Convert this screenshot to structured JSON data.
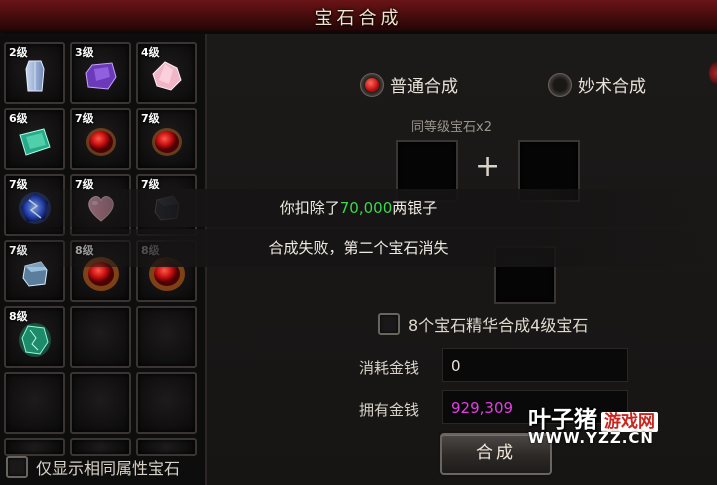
{
  "window": {
    "title": "宝石合成"
  },
  "inventory": {
    "slots": [
      {
        "level": "2级",
        "gem": "blue-crystal-gem-icon"
      },
      {
        "level": "3级",
        "gem": "purple-gem-icon"
      },
      {
        "level": "4级",
        "gem": "pink-crystal-gem-icon"
      },
      {
        "level": "6级",
        "gem": "green-rectangular-gem-icon"
      },
      {
        "level": "7级",
        "gem": "red-oval-gem-icon"
      },
      {
        "level": "7级",
        "gem": "red-oval-gem-icon"
      },
      {
        "level": "7级",
        "gem": "blue-lightning-gem-icon"
      },
      {
        "level": "7级",
        "gem": "pink-heart-gem-icon"
      },
      {
        "level": "7级",
        "gem": "ice-cube-gem-icon"
      },
      {
        "level": "7级",
        "gem": "ice-cube-gem-icon"
      },
      {
        "level": "8级",
        "gem": "red-oval-gem-icon"
      },
      {
        "level": "8级",
        "gem": "red-oval-gem-icon"
      },
      {
        "level": "8级",
        "gem": "green-cracked-gem-icon"
      }
    ],
    "show_same_label": "仅显示相同属性宝石"
  },
  "synthesis": {
    "modes": [
      {
        "label": "普通合成",
        "selected": true
      },
      {
        "label": "妙术合成",
        "selected": false
      }
    ],
    "hint": "同等级宝石x2",
    "plus": "+",
    "notice_1": {
      "prefix": "你扣除了",
      "amount": "70,000",
      "suffix": "两银子"
    },
    "notice_2": "合成失败，第二个宝石消失",
    "combine8_label": "8个宝石精华合成4级宝石",
    "cost_label": "消耗金钱",
    "cost_value": "0",
    "owned_label": "拥有金钱",
    "owned_value": "929,309",
    "button": "合成"
  },
  "watermark": {
    "line1": "叶子猪",
    "line1_box": "游戏网",
    "line2": "WWW.YZZ.CN"
  },
  "colors": {
    "highlight_green": "#3bd84a",
    "money_magenta": "#e040e0",
    "title_red": "#6a1416"
  }
}
